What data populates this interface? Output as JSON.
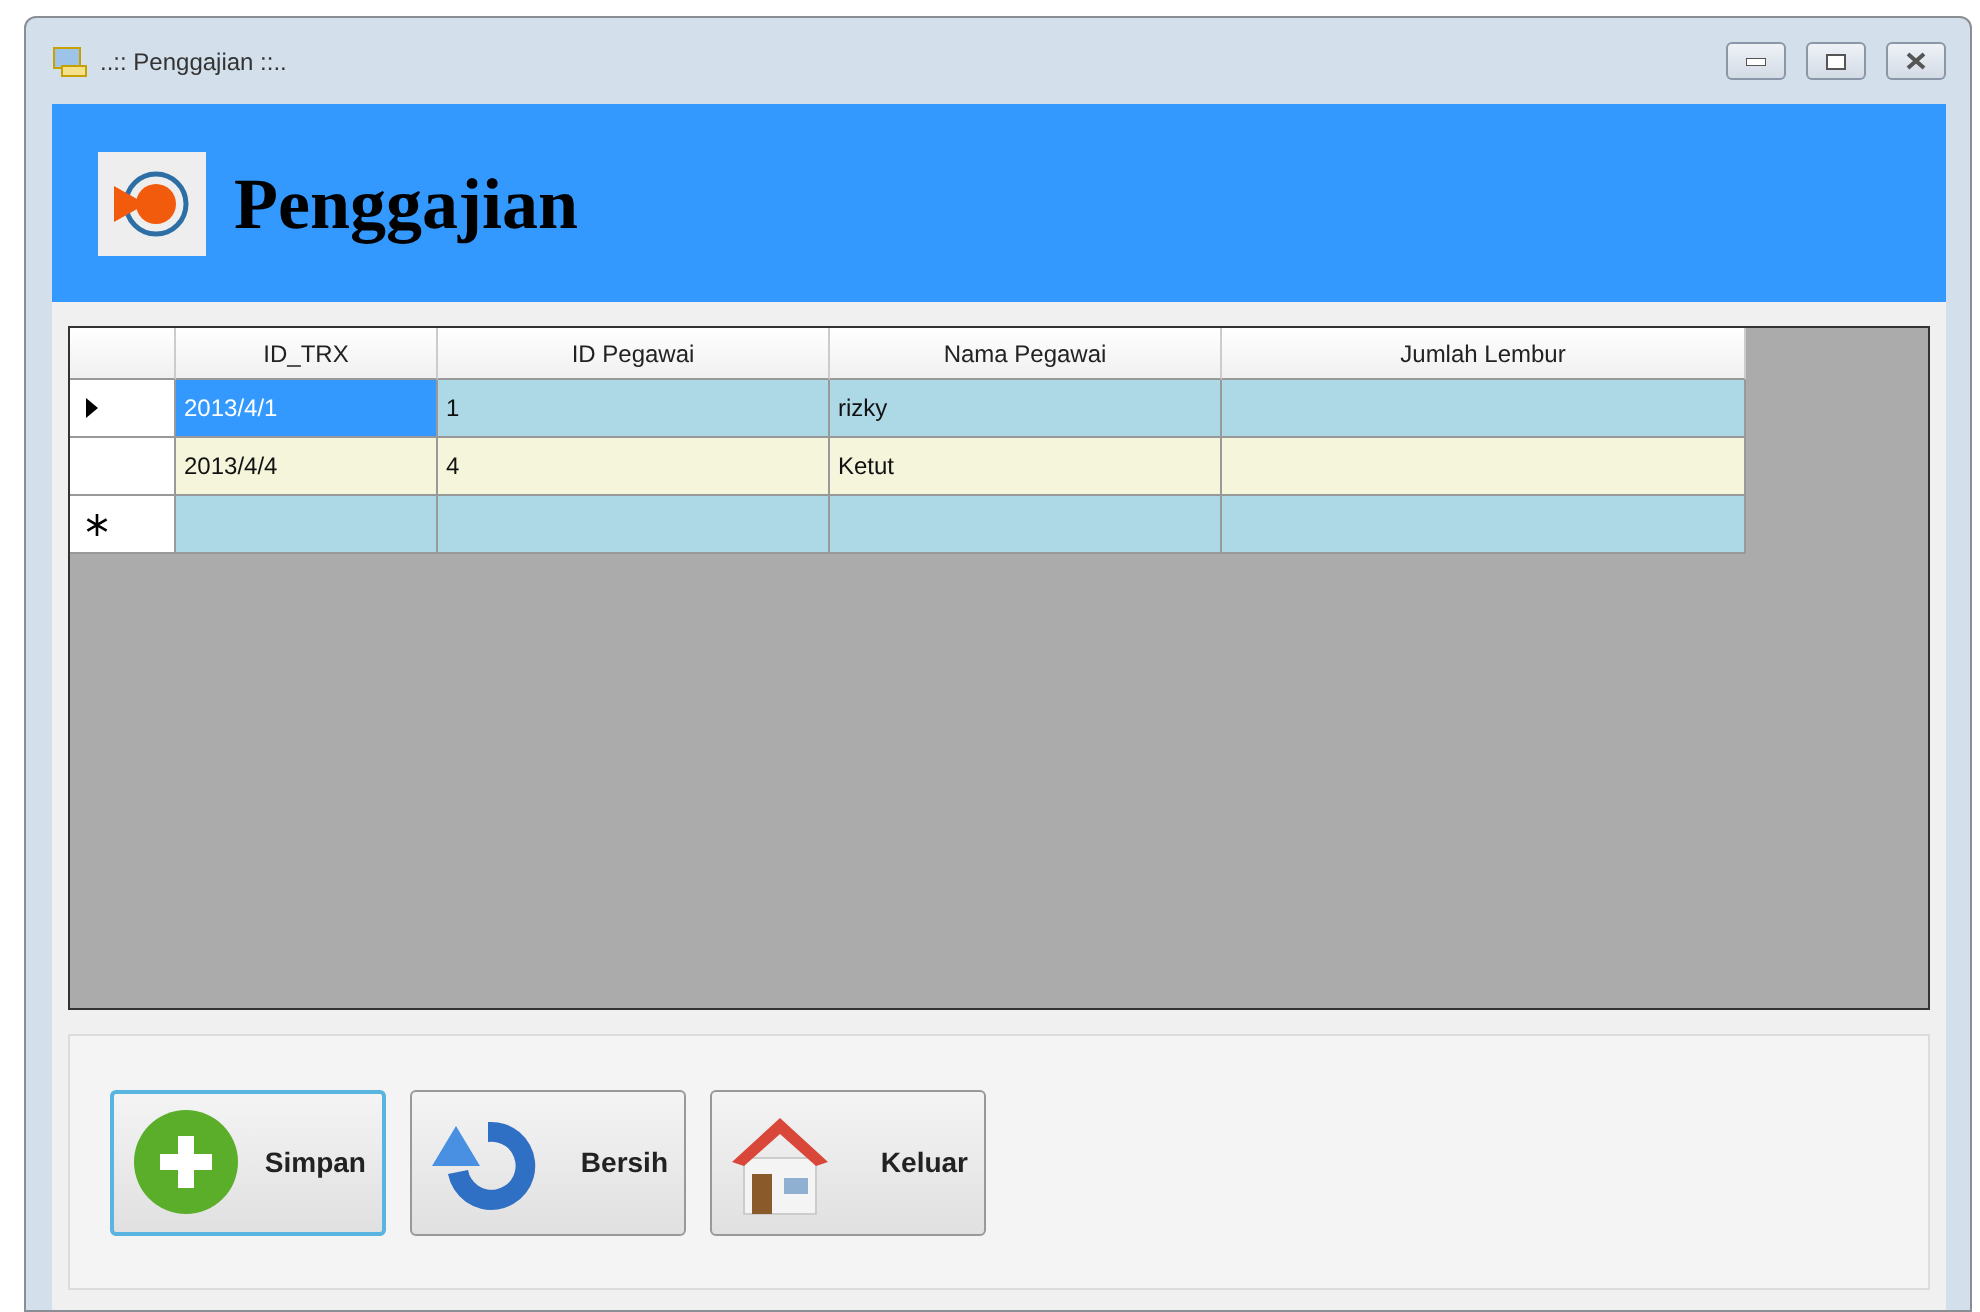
{
  "window": {
    "title": "..:: Penggajian ::.."
  },
  "header": {
    "title": "Penggajian"
  },
  "table": {
    "columns": [
      "ID_TRX",
      "ID Pegawai",
      "Nama Pegawai",
      "Jumlah Lembur"
    ],
    "rows": [
      {
        "kind": "current",
        "cells": [
          {
            "text": "2013/4/1",
            "selected": true
          },
          {
            "text": "1",
            "selected": false
          },
          {
            "text": "rizky",
            "selected": false
          },
          {
            "selected": false
          }
        ]
      },
      {
        "kind": "data",
        "cells": [
          {
            "text": "2013/4/4",
            "selected": false
          },
          {
            "text": "4",
            "selected": false
          },
          {
            "text": "Ketut",
            "selected": false
          },
          {
            "selected": false
          }
        ]
      },
      {
        "kind": "new"
      }
    ]
  },
  "buttons": [
    {
      "label": "Simpan",
      "kind": "add",
      "focused": true
    },
    {
      "label": "Bersih",
      "kind": "refresh",
      "focused": false
    },
    {
      "label": "Keluar",
      "kind": "home",
      "focused": false
    }
  ]
}
